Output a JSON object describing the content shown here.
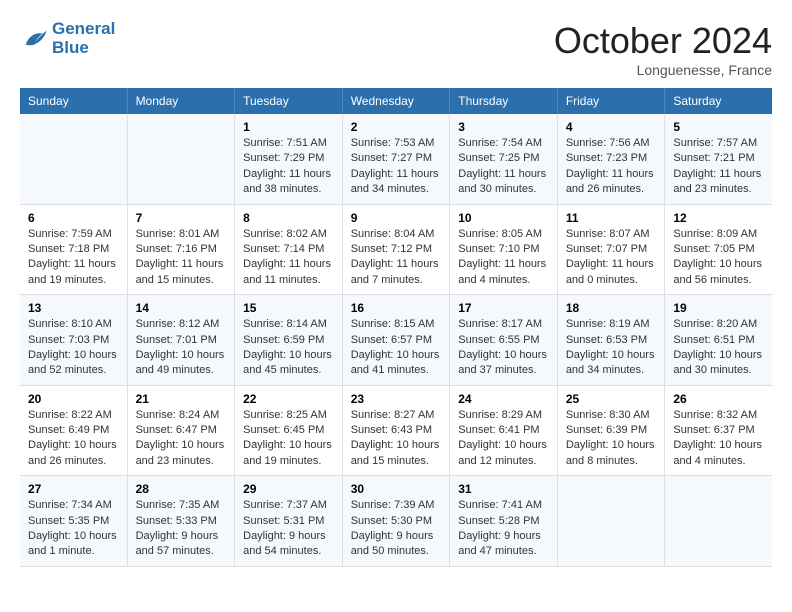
{
  "header": {
    "logo_line1": "General",
    "logo_line2": "Blue",
    "month": "October 2024",
    "location": "Longuenesse, France"
  },
  "days_of_week": [
    "Sunday",
    "Monday",
    "Tuesday",
    "Wednesday",
    "Thursday",
    "Friday",
    "Saturday"
  ],
  "weeks": [
    [
      {
        "day": "",
        "info": ""
      },
      {
        "day": "",
        "info": ""
      },
      {
        "day": "1",
        "info": "Sunrise: 7:51 AM\nSunset: 7:29 PM\nDaylight: 11 hours\nand 38 minutes."
      },
      {
        "day": "2",
        "info": "Sunrise: 7:53 AM\nSunset: 7:27 PM\nDaylight: 11 hours\nand 34 minutes."
      },
      {
        "day": "3",
        "info": "Sunrise: 7:54 AM\nSunset: 7:25 PM\nDaylight: 11 hours\nand 30 minutes."
      },
      {
        "day": "4",
        "info": "Sunrise: 7:56 AM\nSunset: 7:23 PM\nDaylight: 11 hours\nand 26 minutes."
      },
      {
        "day": "5",
        "info": "Sunrise: 7:57 AM\nSunset: 7:21 PM\nDaylight: 11 hours\nand 23 minutes."
      }
    ],
    [
      {
        "day": "6",
        "info": "Sunrise: 7:59 AM\nSunset: 7:18 PM\nDaylight: 11 hours\nand 19 minutes."
      },
      {
        "day": "7",
        "info": "Sunrise: 8:01 AM\nSunset: 7:16 PM\nDaylight: 11 hours\nand 15 minutes."
      },
      {
        "day": "8",
        "info": "Sunrise: 8:02 AM\nSunset: 7:14 PM\nDaylight: 11 hours\nand 11 minutes."
      },
      {
        "day": "9",
        "info": "Sunrise: 8:04 AM\nSunset: 7:12 PM\nDaylight: 11 hours\nand 7 minutes."
      },
      {
        "day": "10",
        "info": "Sunrise: 8:05 AM\nSunset: 7:10 PM\nDaylight: 11 hours\nand 4 minutes."
      },
      {
        "day": "11",
        "info": "Sunrise: 8:07 AM\nSunset: 7:07 PM\nDaylight: 11 hours\nand 0 minutes."
      },
      {
        "day": "12",
        "info": "Sunrise: 8:09 AM\nSunset: 7:05 PM\nDaylight: 10 hours\nand 56 minutes."
      }
    ],
    [
      {
        "day": "13",
        "info": "Sunrise: 8:10 AM\nSunset: 7:03 PM\nDaylight: 10 hours\nand 52 minutes."
      },
      {
        "day": "14",
        "info": "Sunrise: 8:12 AM\nSunset: 7:01 PM\nDaylight: 10 hours\nand 49 minutes."
      },
      {
        "day": "15",
        "info": "Sunrise: 8:14 AM\nSunset: 6:59 PM\nDaylight: 10 hours\nand 45 minutes."
      },
      {
        "day": "16",
        "info": "Sunrise: 8:15 AM\nSunset: 6:57 PM\nDaylight: 10 hours\nand 41 minutes."
      },
      {
        "day": "17",
        "info": "Sunrise: 8:17 AM\nSunset: 6:55 PM\nDaylight: 10 hours\nand 37 minutes."
      },
      {
        "day": "18",
        "info": "Sunrise: 8:19 AM\nSunset: 6:53 PM\nDaylight: 10 hours\nand 34 minutes."
      },
      {
        "day": "19",
        "info": "Sunrise: 8:20 AM\nSunset: 6:51 PM\nDaylight: 10 hours\nand 30 minutes."
      }
    ],
    [
      {
        "day": "20",
        "info": "Sunrise: 8:22 AM\nSunset: 6:49 PM\nDaylight: 10 hours\nand 26 minutes."
      },
      {
        "day": "21",
        "info": "Sunrise: 8:24 AM\nSunset: 6:47 PM\nDaylight: 10 hours\nand 23 minutes."
      },
      {
        "day": "22",
        "info": "Sunrise: 8:25 AM\nSunset: 6:45 PM\nDaylight: 10 hours\nand 19 minutes."
      },
      {
        "day": "23",
        "info": "Sunrise: 8:27 AM\nSunset: 6:43 PM\nDaylight: 10 hours\nand 15 minutes."
      },
      {
        "day": "24",
        "info": "Sunrise: 8:29 AM\nSunset: 6:41 PM\nDaylight: 10 hours\nand 12 minutes."
      },
      {
        "day": "25",
        "info": "Sunrise: 8:30 AM\nSunset: 6:39 PM\nDaylight: 10 hours\nand 8 minutes."
      },
      {
        "day": "26",
        "info": "Sunrise: 8:32 AM\nSunset: 6:37 PM\nDaylight: 10 hours\nand 4 minutes."
      }
    ],
    [
      {
        "day": "27",
        "info": "Sunrise: 7:34 AM\nSunset: 5:35 PM\nDaylight: 10 hours\nand 1 minute."
      },
      {
        "day": "28",
        "info": "Sunrise: 7:35 AM\nSunset: 5:33 PM\nDaylight: 9 hours\nand 57 minutes."
      },
      {
        "day": "29",
        "info": "Sunrise: 7:37 AM\nSunset: 5:31 PM\nDaylight: 9 hours\nand 54 minutes."
      },
      {
        "day": "30",
        "info": "Sunrise: 7:39 AM\nSunset: 5:30 PM\nDaylight: 9 hours\nand 50 minutes."
      },
      {
        "day": "31",
        "info": "Sunrise: 7:41 AM\nSunset: 5:28 PM\nDaylight: 9 hours\nand 47 minutes."
      },
      {
        "day": "",
        "info": ""
      },
      {
        "day": "",
        "info": ""
      }
    ]
  ]
}
